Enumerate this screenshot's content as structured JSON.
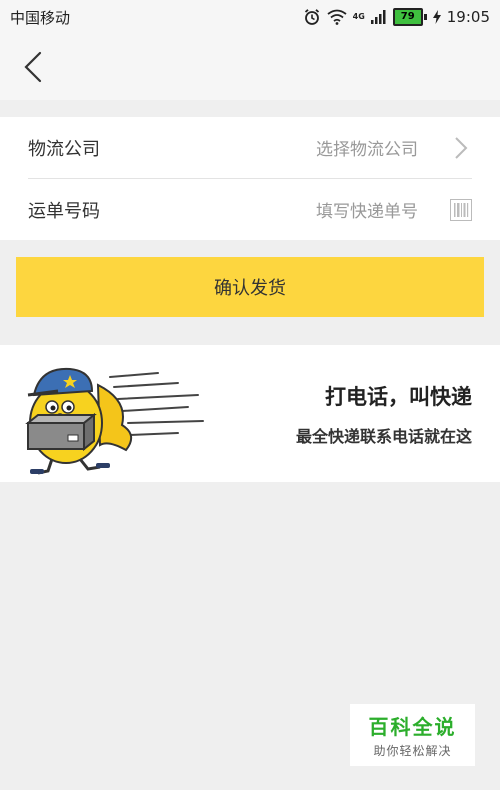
{
  "status_bar": {
    "carrier": "中国移动",
    "network": "4G",
    "battery": "79",
    "time": "19:05"
  },
  "form": {
    "company_label": "物流公司",
    "company_placeholder": "选择物流公司",
    "tracking_label": "运单号码",
    "tracking_placeholder": "填写快递单号"
  },
  "confirm_button": "确认发货",
  "banner": {
    "title": "打电话，叫快递",
    "subtitle": "最全快递联系电话就在这"
  },
  "watermark": {
    "brand": "百科全说",
    "slogan": "助你轻松解决"
  },
  "colors": {
    "accent": "#fdd63f",
    "background": "#efefef"
  }
}
